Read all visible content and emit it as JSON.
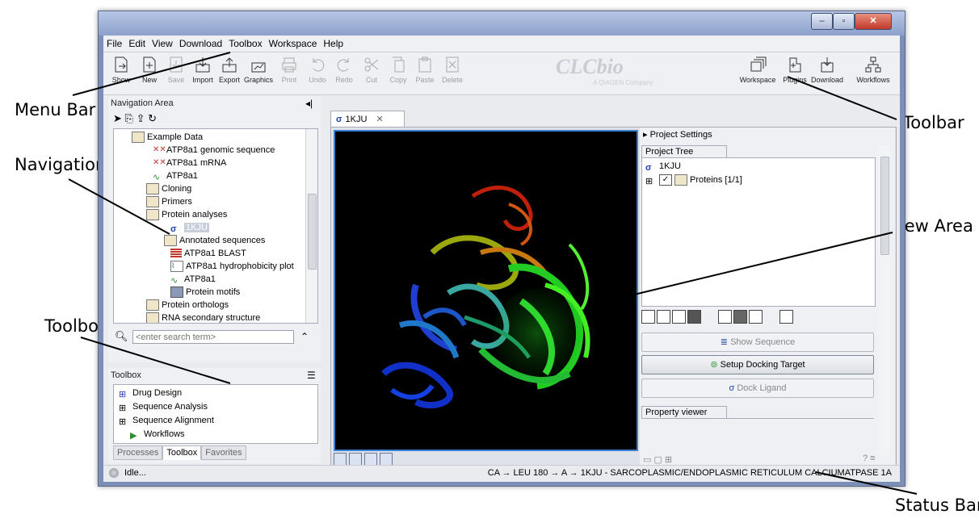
{
  "callouts": {
    "menu_bar": "Menu Bar",
    "toolbar": "Toolbar",
    "navigation_area": "Navigation Area",
    "view_area": "View Area",
    "toolbox": "Toolbox",
    "status_bar": "Status Bar"
  },
  "menu": [
    "File",
    "Edit",
    "View",
    "Download",
    "Toolbox",
    "Workspace",
    "Help"
  ],
  "toolbar": {
    "left": [
      "Show",
      "New",
      "Save",
      "Import",
      "Export",
      "Graphics",
      "Print",
      "Undo",
      "Redo",
      "Cut",
      "Copy",
      "Paste",
      "Delete"
    ],
    "right": [
      "Workspace",
      "Plugins",
      "Download",
      "Workflows"
    ],
    "logo": "CLCbio",
    "logo_sub": "A QIAGEN Company"
  },
  "navigation": {
    "title": "Navigation Area",
    "items": [
      {
        "label": "Example Data",
        "icon": "folder-icon"
      },
      {
        "label": "ATP8a1 genomic sequence",
        "icon": "dna-icon"
      },
      {
        "label": "ATP8a1 mRNA",
        "icon": "dna-icon"
      },
      {
        "label": "ATP8a1",
        "icon": "protein-icon"
      },
      {
        "label": "Cloning",
        "icon": "folder-icon"
      },
      {
        "label": "Primers",
        "icon": "folder-icon"
      },
      {
        "label": "Protein analyses",
        "icon": "folder-icon"
      },
      {
        "label": "1KJU",
        "icon": "molecule-icon"
      },
      {
        "label": "Annotated sequences",
        "icon": "folder-icon"
      },
      {
        "label": "ATP8a1 BLAST",
        "icon": "blast-icon"
      },
      {
        "label": "ATP8a1 hydrophobicity plot",
        "icon": "plot-icon"
      },
      {
        "label": "ATP8a1",
        "icon": "protein-icon"
      },
      {
        "label": "Protein motifs",
        "icon": "motif-icon"
      },
      {
        "label": "Protein orthologs",
        "icon": "folder-icon"
      },
      {
        "label": "RNA secondary structure",
        "icon": "folder-icon"
      }
    ],
    "search_placeholder": "<enter search term>"
  },
  "toolbox": {
    "title": "Toolbox",
    "items": [
      "Drug Design",
      "Sequence Analysis",
      "Sequence Alignment",
      "Workflows"
    ],
    "tabs": [
      "Processes",
      "Toolbox",
      "Favorites"
    ],
    "active_tab": "Toolbox"
  },
  "editor": {
    "tab_label": "1KJU",
    "project_settings": "Project Settings",
    "project_tree_tab": "Project Tree",
    "tree": [
      {
        "label": "1KJU"
      },
      {
        "label": "Proteins [1/1]"
      }
    ],
    "buttons": {
      "show_sequence": "Show Sequence",
      "setup_docking": "Setup Docking Target",
      "dock_ligand": "Dock Ligand"
    },
    "property_viewer_tab": "Property viewer"
  },
  "status": {
    "idle": "Idle...",
    "path": "CA → LEU 180 → A → 1KJU - SARCOPLASMIC/ENDOPLASMIC RETICULUM CALCIUMATPASE 1A"
  }
}
